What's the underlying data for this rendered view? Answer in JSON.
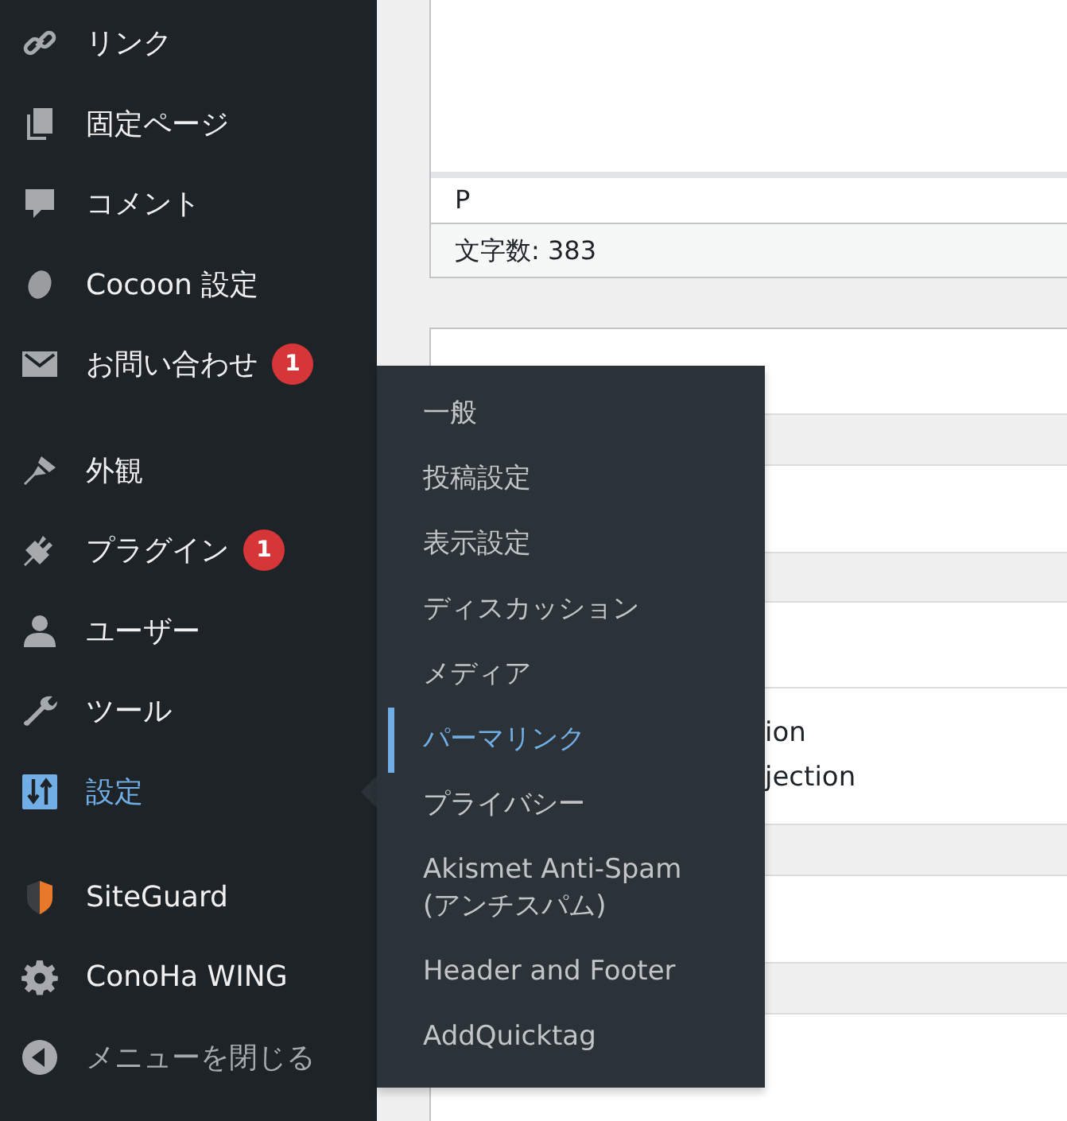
{
  "sidebar": {
    "groups": [
      [
        {
          "label": "リンク",
          "selected": false
        },
        {
          "label": "固定ページ",
          "selected": false
        },
        {
          "label": "コメント",
          "selected": false
        },
        {
          "label": "Cocoon 設定",
          "selected": false
        },
        {
          "label": "お問い合わせ",
          "badge": "1",
          "selected": false
        }
      ],
      [
        {
          "label": "外観",
          "selected": false
        },
        {
          "label": "プラグイン",
          "badge": "1",
          "selected": false
        },
        {
          "label": "ユーザー",
          "selected": false
        },
        {
          "label": "ツール",
          "selected": false
        },
        {
          "label": "設定",
          "selected": true
        }
      ],
      [
        {
          "label": "SiteGuard",
          "selected": false
        },
        {
          "label": "ConoHa WING",
          "selected": false
        },
        {
          "label": "メニューを閉じる",
          "selected": false,
          "kind": "collapse"
        }
      ]
    ]
  },
  "submenu": {
    "items": [
      {
        "label": "一般",
        "selected": false
      },
      {
        "label": "投稿設定",
        "selected": false
      },
      {
        "label": "表示設定",
        "selected": false
      },
      {
        "label": "ディスカッション",
        "selected": false
      },
      {
        "label": "メディア",
        "selected": false
      },
      {
        "label": "パーマリンク",
        "selected": true
      },
      {
        "label": "プライバシー",
        "selected": false
      },
      {
        "label": "Akismet Anti-Spam (アンチスパム)",
        "selected": false
      },
      {
        "label": "Header and Footer",
        "selected": false
      },
      {
        "label": "AddQuicktag",
        "selected": false
      }
    ]
  },
  "editor": {
    "path": "P",
    "word_count": "文字数: 383"
  },
  "meta_box": {
    "lines": [
      "ion",
      "jection"
    ]
  }
}
